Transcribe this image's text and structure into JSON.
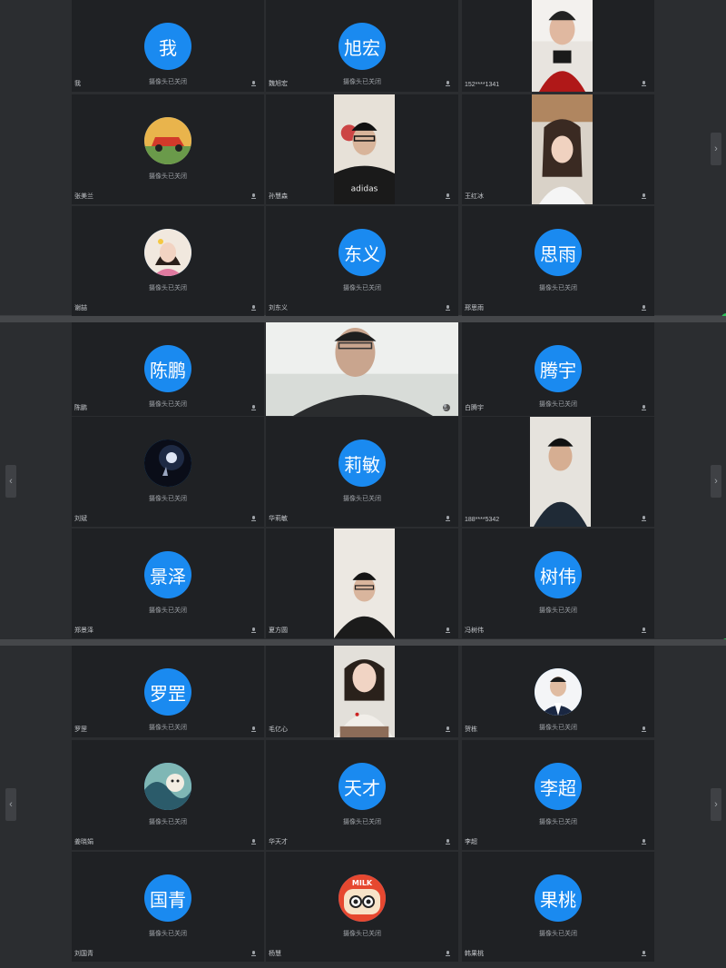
{
  "status_text": "摄像头已关闭",
  "nav": {
    "prev": "‹",
    "next": "›"
  },
  "colors": {
    "avatar": "#1a8af0",
    "tile": "#1f2124",
    "panel": "#2b2d30"
  },
  "panels": [
    {
      "tiles": [
        {
          "name": "我",
          "avatar_text": "我",
          "kind": "text"
        },
        {
          "name": "魏旭宏",
          "avatar_text": "旭宏",
          "kind": "text"
        },
        {
          "name": "152****1341",
          "kind": "video"
        },
        {
          "name": "张美兰",
          "kind": "pic",
          "pic": "car"
        },
        {
          "name": "孙慧森",
          "kind": "video"
        },
        {
          "name": "王红冰",
          "kind": "video"
        },
        {
          "name": "谢喆",
          "kind": "pic",
          "pic": "girl"
        },
        {
          "name": "刘东义",
          "avatar_text": "东义",
          "kind": "text"
        },
        {
          "name": "邢思雨",
          "avatar_text": "思雨",
          "kind": "text"
        }
      ]
    },
    {
      "tiles": [
        {
          "name": "陈鹏",
          "avatar_text": "陈鹏",
          "kind": "text"
        },
        {
          "name": "",
          "kind": "video-large"
        },
        {
          "name": "白腾宇",
          "avatar_text": "腾宇",
          "kind": "text"
        },
        {
          "name": "刘斌",
          "kind": "pic",
          "pic": "night"
        },
        {
          "name": "华莉敏",
          "avatar_text": "莉敏",
          "kind": "text"
        },
        {
          "name": "188****5342",
          "kind": "video"
        },
        {
          "name": "郑景泽",
          "avatar_text": "景泽",
          "kind": "text"
        },
        {
          "name": "夏方圆",
          "kind": "video"
        },
        {
          "name": "冯树伟",
          "avatar_text": "树伟",
          "kind": "text"
        }
      ]
    },
    {
      "tiles": [
        {
          "name": "罗罡",
          "avatar_text": "罗罡",
          "kind": "text"
        },
        {
          "name": "毛亿心",
          "kind": "video"
        },
        {
          "name": "贺栋",
          "kind": "pic",
          "pic": "suit"
        },
        {
          "name": "姜晓娟",
          "kind": "pic",
          "pic": "art"
        },
        {
          "name": "华天才",
          "avatar_text": "天才",
          "kind": "text"
        },
        {
          "name": "李超",
          "avatar_text": "李超",
          "kind": "text"
        },
        {
          "name": "刘国青",
          "avatar_text": "国青",
          "kind": "text"
        },
        {
          "name": "杨慧",
          "kind": "pic",
          "pic": "cartoon"
        },
        {
          "name": "韩果桃",
          "avatar_text": "果桃",
          "kind": "text"
        }
      ]
    }
  ]
}
